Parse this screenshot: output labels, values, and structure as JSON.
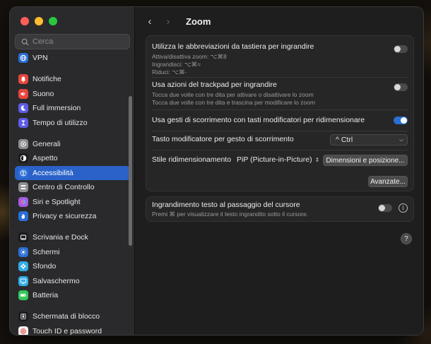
{
  "window": {
    "search_placeholder": "Cerca",
    "page_title": "Zoom"
  },
  "sidebar": {
    "items": [
      {
        "label": "VPN",
        "icon": "globe-icon",
        "color": "#2a6fd6"
      },
      {
        "label": "Notifiche",
        "icon": "bell-icon",
        "color": "#e8453c"
      },
      {
        "label": "Suono",
        "icon": "speaker-icon",
        "color": "#e8453c"
      },
      {
        "label": "Full immersion",
        "icon": "moon-icon",
        "color": "#5e5ce6"
      },
      {
        "label": "Tempo di utilizzo",
        "icon": "hourglass-icon",
        "color": "#5e5ce6"
      },
      {
        "label": "Generali",
        "icon": "gear-icon",
        "color": "#8e8e93"
      },
      {
        "label": "Aspetto",
        "icon": "appearance-icon",
        "color": "#1c1c1e"
      },
      {
        "label": "Accessibilità",
        "icon": "accessibility-icon",
        "color": "#2a6fd6"
      },
      {
        "label": "Centro di Controllo",
        "icon": "control-center-icon",
        "color": "#8e8e93"
      },
      {
        "label": "Siri e Spotlight",
        "icon": "siri-icon",
        "color": "#a35be0"
      },
      {
        "label": "Privacy e sicurezza",
        "icon": "hand-icon",
        "color": "#2a6fd6"
      },
      {
        "label": "Scrivania e Dock",
        "icon": "dock-icon",
        "color": "#1c1c1e"
      },
      {
        "label": "Schermi",
        "icon": "sun-icon",
        "color": "#2a6fd6"
      },
      {
        "label": "Sfondo",
        "icon": "flower-icon",
        "color": "#32ade6"
      },
      {
        "label": "Salvaschermo",
        "icon": "screensaver-icon",
        "color": "#32ade6"
      },
      {
        "label": "Batteria",
        "icon": "battery-icon",
        "color": "#34c759"
      },
      {
        "label": "Schermata di blocco",
        "icon": "lock-screen-icon",
        "color": "#1c1c1e"
      },
      {
        "label": "Touch ID e password",
        "icon": "fingerprint-icon",
        "color": "#f2f2f2"
      }
    ],
    "active_index": 7
  },
  "zoom": {
    "keyboard_shortcuts": {
      "label": "Utilizza le abbreviazioni da tastiera per ingrandire",
      "lines": [
        "Attiva/disattiva zoom: ⌥⌘8",
        "Ingrandisci: ⌥⌘=",
        "Riduci: ⌥⌘-"
      ],
      "enabled": false
    },
    "trackpad": {
      "label": "Usa azioni del trackpad per ingrandire",
      "lines": [
        "Tocca due volte con tre dita per attivare o disattivare lo zoom",
        "Tocca due volte con tre dita e trascina per modificare lo zoom"
      ],
      "enabled": false
    },
    "scroll_gesture": {
      "label": "Usa gesti di scorrimento con tasti modificatori per ridimensionare",
      "enabled": true
    },
    "modifier_key": {
      "label": "Tasto modificatore per gesto di scorrimento",
      "value": "^ Ctrl"
    },
    "zoom_style": {
      "label": "Stile ridimensionamento",
      "value": "PiP (Picture-in-Picture)",
      "button": "Dimensioni e posizione..."
    },
    "advanced_button": "Avanzate...",
    "hover_text": {
      "label": "Ingrandimento testo al passaggio del cursore",
      "sub": "Premi ⌘ per visualizzare il testo ingrandito sotto il cursore.",
      "enabled": false,
      "info": "i"
    },
    "help": "?"
  }
}
